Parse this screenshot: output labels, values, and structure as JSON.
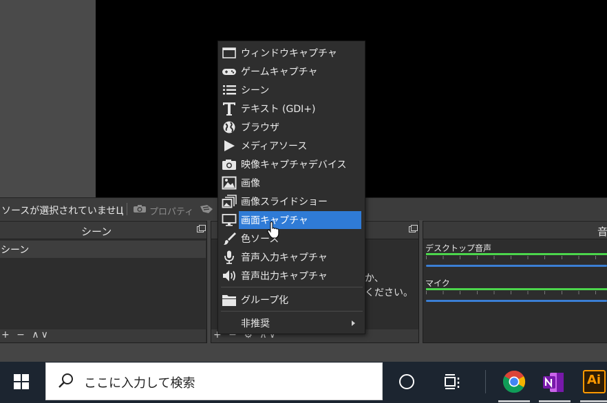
{
  "toolbar": {
    "no_source": "ソースが選択されていませЦ",
    "properties": "プロパティ"
  },
  "scene_dock": {
    "title": "シーン",
    "item": "シーン",
    "tools": "+ −  ∧∨"
  },
  "source_dock": {
    "hint_line1": "か、",
    "hint_line2": "ください。",
    "tools": "+ − ⚙  ∧∨"
  },
  "audio_dock": {
    "title": "音",
    "desktop": "デスクトップ音声",
    "mic": "マイク"
  },
  "menu": {
    "items": [
      {
        "label": "ウィンドウキャプチャ",
        "icon": "window-icon"
      },
      {
        "label": "ゲームキャプチャ",
        "icon": "gamepad-icon"
      },
      {
        "label": "シーン",
        "icon": "list-icon"
      },
      {
        "label": "テキスト (GDI+)",
        "icon": "text-icon"
      },
      {
        "label": "ブラウザ",
        "icon": "globe-icon"
      },
      {
        "label": "メディアソース",
        "icon": "play-icon"
      },
      {
        "label": "映像キャプチャデバイス",
        "icon": "camera-icon"
      },
      {
        "label": "画像",
        "icon": "image-icon"
      },
      {
        "label": "画像スライドショー",
        "icon": "slideshow-icon"
      },
      {
        "label": "画面キャプチャ",
        "icon": "monitor-icon"
      },
      {
        "label": "色ソース",
        "icon": "brush-icon"
      },
      {
        "label": "音声入力キャプチャ",
        "icon": "microphone-icon"
      },
      {
        "label": "音声出力キャプチャ",
        "icon": "speaker-icon"
      },
      {
        "label": "グループ化",
        "icon": "folder-icon"
      },
      {
        "label": "非推奨",
        "icon": ""
      }
    ],
    "selected_index": 9
  },
  "taskbar": {
    "search_placeholder": "ここに入力して検索",
    "ai_label": "Ai"
  },
  "colors": {
    "highlight": "#2f7bd6",
    "meter_green": "#4cd64c",
    "meter_blue": "#3b7fd4"
  }
}
